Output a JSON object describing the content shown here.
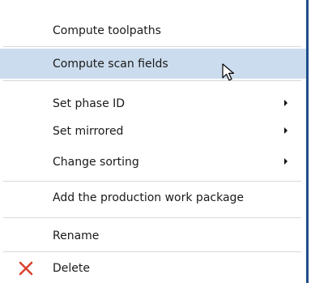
{
  "menu": {
    "items": [
      {
        "label": "Compute toolpaths"
      },
      {
        "label": "Compute scan fields",
        "state": "hovered"
      },
      {
        "label": "Set phase ID",
        "submenu": true
      },
      {
        "label": "Set mirrored",
        "submenu": true
      },
      {
        "label": "Change sorting",
        "submenu": true
      },
      {
        "label": "Add the production work package"
      },
      {
        "label": "Rename"
      },
      {
        "label": "Delete",
        "icon": "close-x-icon"
      }
    ]
  },
  "colors": {
    "hover_background": "#cbdcee",
    "frame_border": "#1d4e8a",
    "delete_icon": "#d9432c",
    "separator": "#d9d9d9"
  },
  "cursor": {
    "icon": "mouse-pointer-icon"
  }
}
